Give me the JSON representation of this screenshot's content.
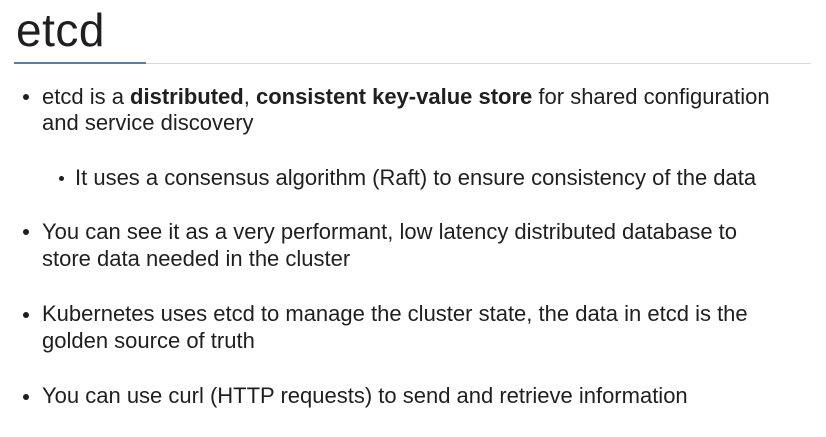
{
  "slide": {
    "title": "etcd",
    "bullets": [
      {
        "line1": {
          "prefix": "etcd is a ",
          "bold1": "distributed",
          "mid": ", ",
          "bold2": "consistent key-value store",
          "suffix": " for shared configuration"
        },
        "line2": "and service discovery"
      },
      {
        "line1": "It uses a consensus algorithm (Raft) to ensure consistency of the data"
      },
      {
        "line1": "You can see it as a very performant, low latency distributed database to",
        "line2": "store data needed in the cluster"
      },
      {
        "line1": "Kubernetes uses etcd to manage the cluster state, the data in etcd is the",
        "line2": "golden source of truth"
      },
      {
        "line1": "You can use curl (HTTP requests) to send and retrieve information"
      }
    ]
  }
}
